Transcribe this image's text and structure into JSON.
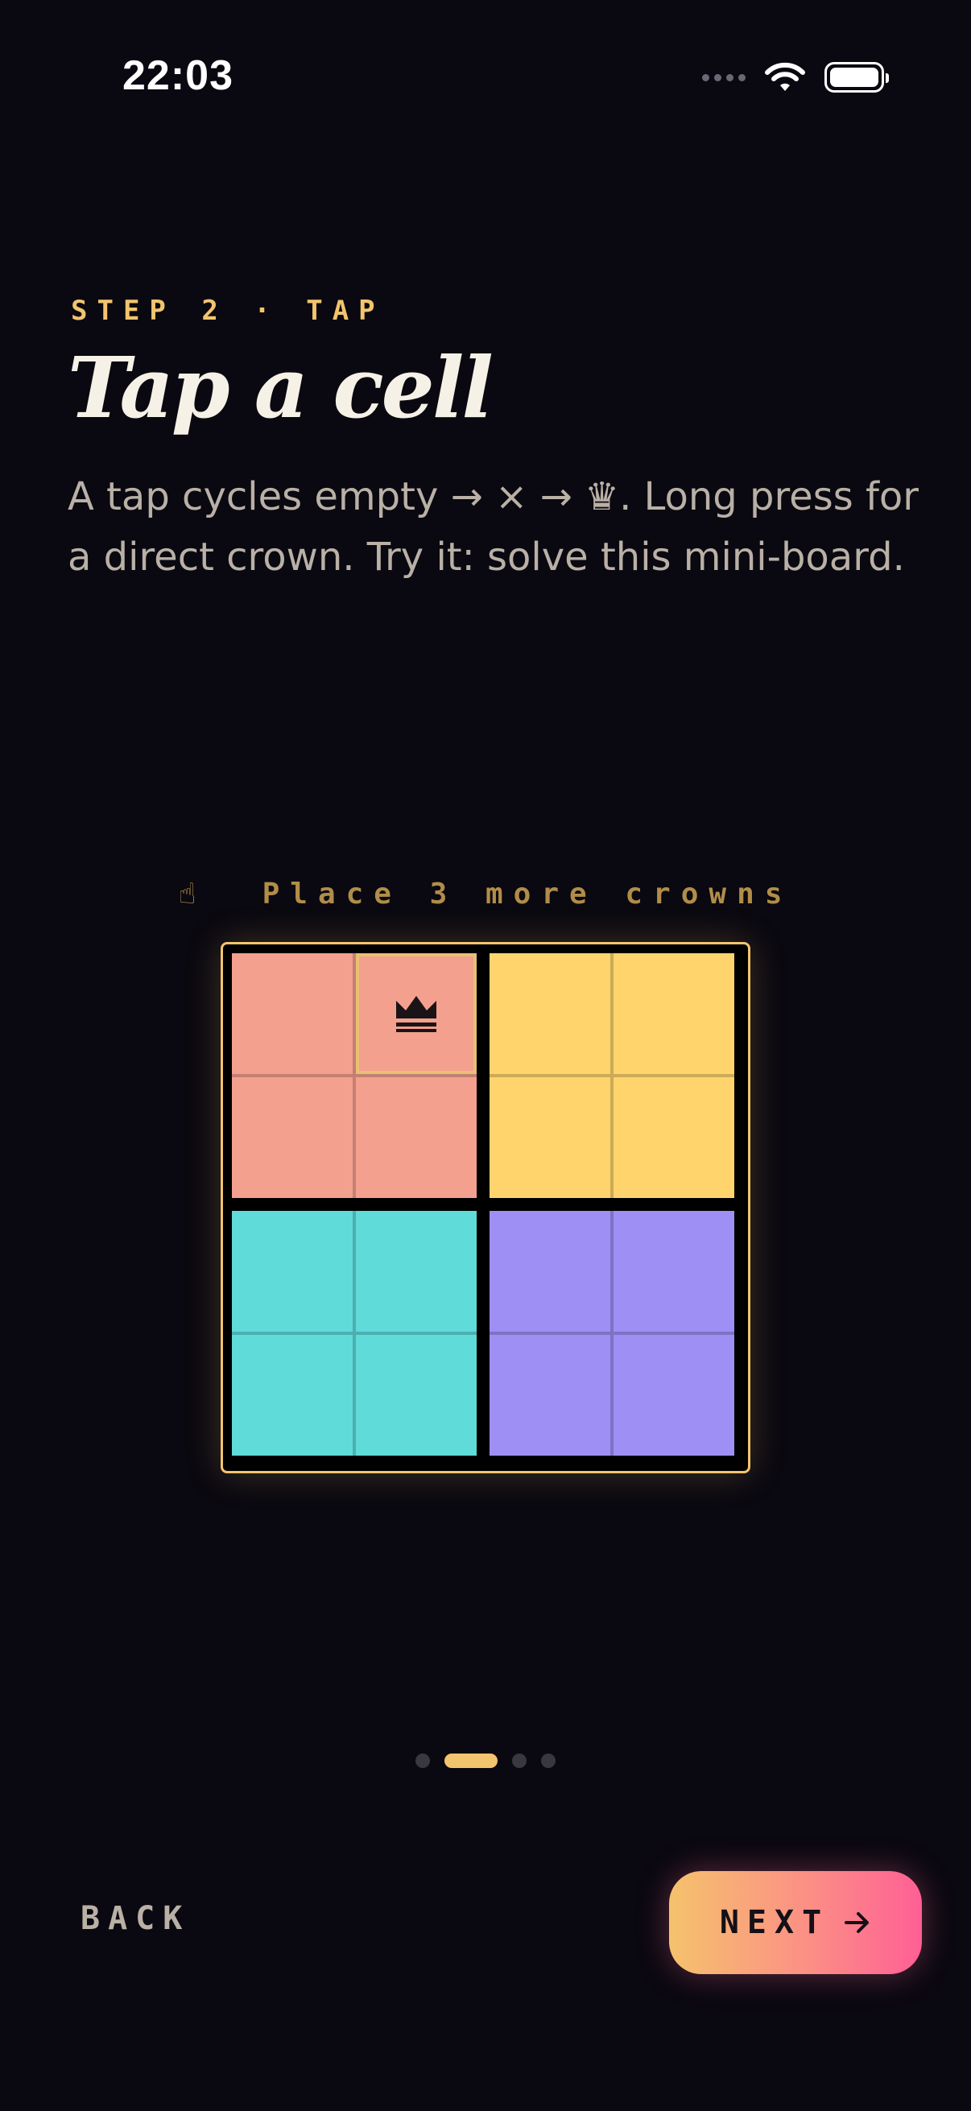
{
  "status_bar": {
    "time": "22:03"
  },
  "step_label": "STEP 2 · TAP",
  "title": "Tap a cell",
  "description": "A tap cycles empty → × → ♛. Long press for a direct crown. Try it: solve this mini-board.",
  "hint": {
    "icon": "tap-hand-icon",
    "glyph": "☝",
    "text": "Place 3 more crowns"
  },
  "board": {
    "size": 4,
    "region_colors": {
      "coral": "#f4a08e",
      "yellow": "#ffd46d",
      "teal": "#5fdbda",
      "purple": "#9e8ff5"
    },
    "regions": [
      [
        "coral",
        "coral",
        "yellow",
        "yellow"
      ],
      [
        "coral",
        "coral",
        "yellow",
        "yellow"
      ],
      [
        "teal",
        "teal",
        "purple",
        "purple"
      ],
      [
        "teal",
        "teal",
        "purple",
        "purple"
      ]
    ],
    "cells": [
      [
        "empty",
        "crown",
        "empty",
        "empty"
      ],
      [
        "empty",
        "empty",
        "empty",
        "empty"
      ],
      [
        "empty",
        "empty",
        "empty",
        "empty"
      ],
      [
        "empty",
        "empty",
        "empty",
        "empty"
      ]
    ],
    "selected": [
      0,
      1
    ]
  },
  "pager": {
    "count": 4,
    "active": 1
  },
  "actions": {
    "back_label": "BACK",
    "next_label": "NEXT"
  },
  "colors": {
    "accent": "#f2c46d",
    "background": "#0a0810"
  }
}
